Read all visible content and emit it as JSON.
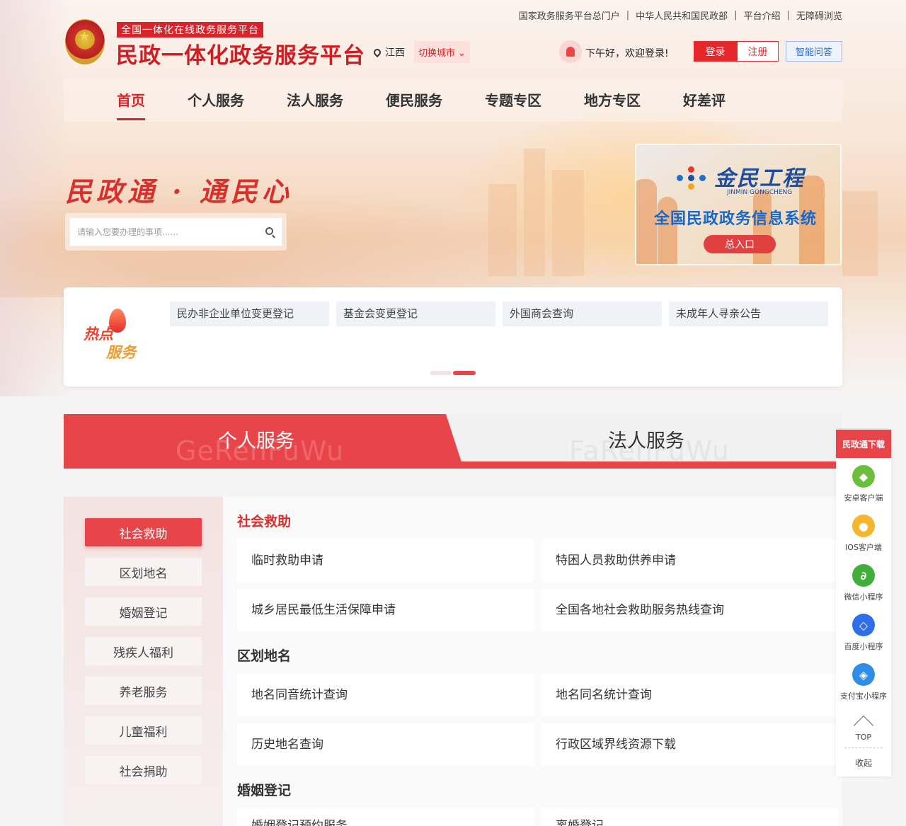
{
  "top_links": [
    "国家政务服务平台总门户",
    "中华人民共和国民政部",
    "平台介绍",
    "无障碍浏览"
  ],
  "top_link_separator": "|",
  "header": {
    "sub_tag": "全国一体化在线政务服务平台",
    "site_title": "民政一体化政务服务平台",
    "location": "江西",
    "switch_city": "切换城市",
    "greeting": "下午好，欢迎登录!",
    "login_label": "登录",
    "register_label": "注册",
    "ai_label": "智能问答"
  },
  "nav": [
    "首页",
    "个人服务",
    "法人服务",
    "便民服务",
    "专题专区",
    "地方专区",
    "好差评"
  ],
  "nav_active_index": 0,
  "hero": {
    "slogan": "民政通 · 通民心",
    "search_placeholder": "请输入您要办理的事项......"
  },
  "jinmin": {
    "name_cn": "金民工程",
    "name_en": "JINMIN GONGCHENG",
    "system": "全国民政政务信息系统",
    "entry": "总入口"
  },
  "hot_services": {
    "badge_line1": "热点",
    "badge_line2": "服务",
    "items": [
      "民办非企业单位变更登记",
      "基金会变更登记",
      "外国商会查询",
      "未成年人寻亲公告"
    ]
  },
  "service_tabs": {
    "personal": "个人服务",
    "personal_pinyin": "GeRenFuWu",
    "legal": "法人服务",
    "legal_pinyin": "FaRenFuWu"
  },
  "sidebar": {
    "items": [
      "社会救助",
      "区划地名",
      "婚姻登记",
      "残疾人福利",
      "养老服务",
      "儿童福利",
      "社会捐助"
    ],
    "active_index": 0
  },
  "sections": [
    {
      "title": "社会救助",
      "items": [
        "临时救助申请",
        "特困人员救助供养申请",
        "城乡居民最低生活保障申请",
        "全国各地社会救助服务热线查询"
      ]
    },
    {
      "title": "区划地名",
      "items": [
        "地名同音统计查询",
        "地名同名统计查询",
        "历史地名查询",
        "行政区域界线资源下载"
      ]
    },
    {
      "title": "婚姻登记",
      "items": [
        "婚姻登记预约服务",
        "离婚登记"
      ]
    }
  ],
  "float_panel": {
    "title": "民政通下载",
    "items": [
      {
        "label": "安卓客户端",
        "icon": "android-icon",
        "color": "#6cbf3c"
      },
      {
        "label": "IOS客户端",
        "icon": "apple-icon",
        "color": "#f6b52d"
      },
      {
        "label": "微信小程序",
        "icon": "wechat-mini-icon",
        "color": "#3fae3a"
      },
      {
        "label": "百度小程序",
        "icon": "baidu-mini-icon",
        "color": "#2f6ee8"
      },
      {
        "label": "支付宝小程序",
        "icon": "alipay-mini-icon",
        "color": "#2f8de8"
      }
    ],
    "top_label": "TOP",
    "collapse_label": "收起"
  },
  "colors": {
    "brand_red": "#d8232a",
    "tab_red": "#e8454a"
  }
}
